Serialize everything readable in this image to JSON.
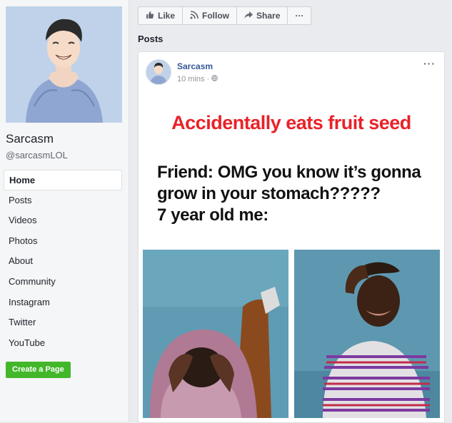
{
  "page": {
    "name": "Sarcasm",
    "handle": "@sarcasmLOL"
  },
  "nav": {
    "items": [
      {
        "label": "Home"
      },
      {
        "label": "Posts"
      },
      {
        "label": "Videos"
      },
      {
        "label": "Photos"
      },
      {
        "label": "About"
      },
      {
        "label": "Community"
      },
      {
        "label": "Instagram"
      },
      {
        "label": "Twitter"
      },
      {
        "label": "YouTube"
      }
    ],
    "active": "Home",
    "create_label": "Create a Page"
  },
  "actions": {
    "like": "Like",
    "follow": "Follow",
    "share": "Share",
    "more": "···"
  },
  "posts_header": "Posts",
  "post": {
    "author": "Sarcasm",
    "time": "10 mins",
    "separator": "·",
    "more": "···",
    "meme": {
      "red_text": "Accidentally eats fruit seed",
      "lines": [
        "Friend: OMG you know it’s gonna",
        "grow in your stomach?????",
        "7 year old me:"
      ]
    }
  },
  "colors": {
    "brand": "#365899",
    "create_button": "#42b72a",
    "meme_red": "#e8222a"
  }
}
